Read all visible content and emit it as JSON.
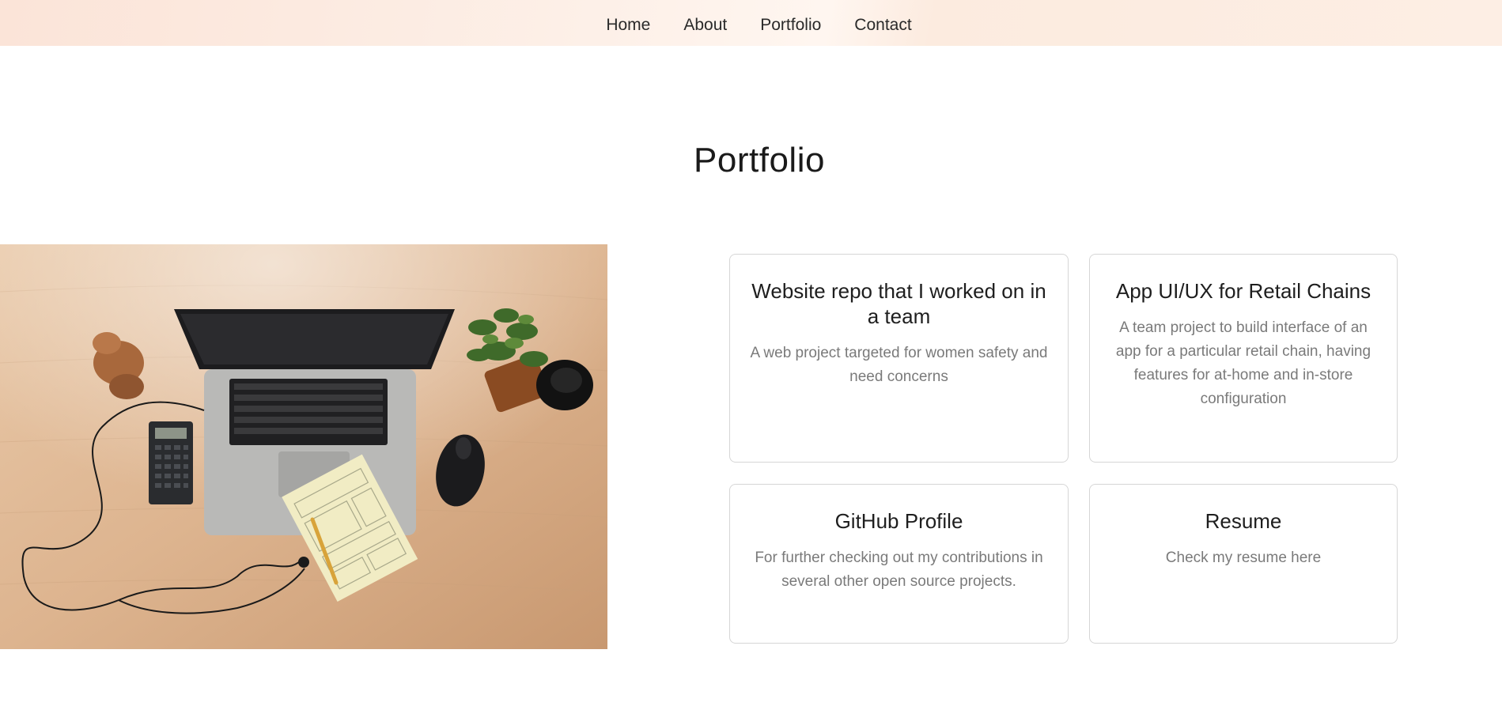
{
  "nav": {
    "items": [
      {
        "label": "Home"
      },
      {
        "label": "About"
      },
      {
        "label": "Portfolio"
      },
      {
        "label": "Contact"
      }
    ]
  },
  "section": {
    "title": "Portfolio"
  },
  "cards": [
    {
      "title": "Website repo that I worked on in a team",
      "description": "A web project targeted for women safety and need concerns"
    },
    {
      "title": "App UI/UX for Retail Chains",
      "description": "A team project to build interface of an app for a particular retail chain, having features for at-home and in-store configuration"
    },
    {
      "title": "GitHub Profile",
      "description": "For further checking out my contributions in several other open source projects."
    },
    {
      "title": "Resume",
      "description": "Check my resume here"
    }
  ],
  "colors": {
    "nav_background": "#fbe4d8",
    "card_border": "#d6d6d6",
    "muted_text": "#7a7a7a"
  }
}
